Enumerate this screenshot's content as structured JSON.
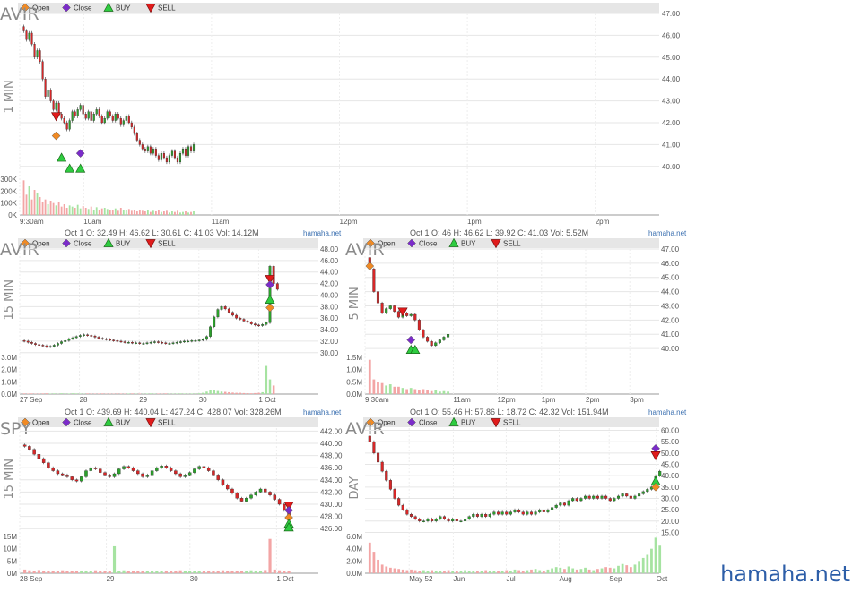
{
  "watermark": "hamaha.net",
  "colors": {
    "up": "#2ca02c",
    "down": "#d62728",
    "open": "#f08a24",
    "close": "#7b2cc9",
    "buy": "#2ecc40",
    "sell": "#e01b1b",
    "vol_up": "#a6e3a1",
    "vol_down": "#f3a5a5",
    "bar": "#e6e6e6",
    "link": "#3a6fb0"
  },
  "legend": [
    "Open",
    "Close",
    "BUY",
    "SELL"
  ],
  "panels": [
    {
      "id": "p1",
      "ticker": "AVIR",
      "timeframe": "1 MIN",
      "info": "Oct 1 O: 46 H: 46.62 L: 39.92 C: 41.03    Vol: 5.52M",
      "site": "hamaha.net",
      "y_ticks": [
        "47.00",
        "46.00",
        "45.00",
        "44.00",
        "43.00",
        "42.00",
        "41.00",
        "40.00"
      ],
      "vol_ticks": [
        "300K",
        "200K",
        "100K",
        "0K"
      ],
      "x_labels": [
        "9:30am",
        "10am",
        "11am",
        "12pm",
        "1pm",
        "2pm"
      ]
    },
    {
      "id": "p2",
      "ticker": "AVIR",
      "timeframe": "15 MIN",
      "info": "Oct 1 O: 32.49 H: 46.62 L: 30.61 C: 41.03    Vol: 14.12M",
      "site": "hamaha.net",
      "y_ticks": [
        "48.00",
        "46.00",
        "44.00",
        "42.00",
        "40.00",
        "38.00",
        "36.00",
        "34.00",
        "32.00",
        "30.00"
      ],
      "vol_ticks": [
        "3.0M",
        "2.0M",
        "1.0M",
        "0.0M"
      ],
      "x_labels": [
        "27 Sep",
        "28",
        "29",
        "30",
        "1 Oct"
      ]
    },
    {
      "id": "p3",
      "ticker": "AVIR",
      "timeframe": "5 MIN",
      "info": "Oct 1 O: 46 H: 46.62 L: 39.92 C: 41.03    Vol: 5.52M",
      "site": "hamaha.net",
      "y_ticks": [
        "47.00",
        "46.00",
        "45.00",
        "44.00",
        "43.00",
        "42.00",
        "41.00",
        "40.00"
      ],
      "vol_ticks": [
        "1.5M",
        "1.0M",
        "0.5M",
        "0.0M"
      ],
      "x_labels": [
        "9:30am",
        "11am",
        "12pm",
        "1pm",
        "2pm",
        "3pm"
      ]
    },
    {
      "id": "p4",
      "ticker": "SPY",
      "timeframe": "15 MIN",
      "info": "Oct 1 O: 439.69 H: 440.04 L: 427.24 C: 428.07    Vol: 328.26M",
      "site": "hamaha.net",
      "y_ticks": [
        "442.00",
        "440.00",
        "438.00",
        "436.00",
        "434.00",
        "432.00",
        "430.00",
        "428.00",
        "426.00"
      ],
      "vol_ticks": [
        "15M",
        "10M",
        "5M",
        "0M"
      ],
      "x_labels": [
        "28 Sep",
        "29",
        "30",
        "1 Oct"
      ]
    },
    {
      "id": "p5",
      "ticker": "AVIR",
      "timeframe": "DAY",
      "info": "Oct 1 O: 55.46 H: 57.86 L: 18.72 C: 42.32    Vol: 151.94M",
      "site": "hamaha.net",
      "y_ticks": [
        "60.00",
        "55.00",
        "50.00",
        "45.00",
        "40.00",
        "35.00",
        "30.00",
        "25.00",
        "20.00",
        "15.00"
      ],
      "vol_ticks": [
        "6.0M",
        "4.0M",
        "2.0M",
        "0.0M"
      ],
      "x_labels": [
        "May 52",
        "Jun",
        "Jul",
        "Aug",
        "Sep",
        "Oct"
      ]
    }
  ],
  "chart_data": [
    {
      "type": "candlestick",
      "ticker": "AVIR",
      "interval": "1 MIN",
      "ylim": [
        39.5,
        47.0
      ],
      "x_labels": [
        "9:30am",
        "10am",
        "11am",
        "12pm",
        "1pm",
        "2pm"
      ],
      "close": [
        46.2,
        45.8,
        46.1,
        45.6,
        45.0,
        45.3,
        44.8,
        44.0,
        43.2,
        43.5,
        43.0,
        42.6,
        42.9,
        42.4,
        42.2,
        42.0,
        41.7,
        42.1,
        42.5,
        42.3,
        42.6,
        42.8,
        42.4,
        42.2,
        42.5,
        42.1,
        42.4,
        42.6,
        42.3,
        42.0,
        42.2,
        42.5,
        42.3,
        42.1,
        42.4,
        42.2,
        41.9,
        42.1,
        42.3,
        42.0,
        41.8,
        41.5,
        41.2,
        41.0,
        40.8,
        40.7,
        40.9,
        40.6,
        40.8,
        40.5,
        40.3,
        40.6,
        40.4,
        40.2,
        40.5,
        40.7,
        40.4,
        40.2,
        40.6,
        40.8,
        40.5,
        40.9,
        40.7,
        41.0
      ],
      "volume_k": [
        290,
        170,
        240,
        130,
        210,
        180,
        150,
        110,
        130,
        90,
        120,
        100,
        80,
        110,
        70,
        90,
        60,
        80,
        70,
        60,
        85,
        55,
        75,
        60,
        50,
        70,
        45,
        65,
        40,
        55,
        60,
        50,
        45,
        40,
        55,
        35,
        60,
        45,
        40,
        50,
        35,
        45,
        30,
        40,
        35,
        30,
        45,
        25,
        35,
        30,
        40,
        25,
        30,
        35,
        20,
        30,
        25,
        35,
        20,
        25,
        30,
        20,
        25,
        30
      ],
      "markers": [
        {
          "type": "open",
          "x": 12,
          "y": 41.4
        },
        {
          "type": "sell",
          "x": 12,
          "y": 42.3
        },
        {
          "type": "buy",
          "x": 14,
          "y": 40.4
        },
        {
          "type": "buy",
          "x": 17,
          "y": 39.9
        },
        {
          "type": "buy",
          "x": 21,
          "y": 39.9
        },
        {
          "type": "close",
          "x": 21,
          "y": 40.6
        }
      ]
    },
    {
      "type": "candlestick",
      "ticker": "AVIR",
      "interval": "15 MIN",
      "ylim": [
        29.5,
        48.0
      ],
      "x_labels": [
        "27 Sep",
        "28",
        "29",
        "30",
        "1 Oct"
      ],
      "close": [
        32.0,
        31.8,
        31.6,
        31.4,
        31.3,
        31.2,
        31.0,
        31.1,
        31.3,
        31.6,
        31.9,
        32.1,
        32.4,
        32.6,
        32.8,
        33.0,
        33.1,
        33.0,
        32.9,
        32.7,
        32.5,
        32.4,
        32.3,
        32.2,
        32.1,
        32.0,
        31.9,
        31.8,
        31.8,
        31.7,
        31.7,
        31.6,
        31.6,
        31.7,
        31.8,
        31.9,
        31.8,
        31.7,
        31.6,
        31.6,
        31.7,
        31.8,
        31.9,
        32.0,
        32.0,
        32.1,
        32.1,
        32.2,
        32.3,
        32.8,
        34.5,
        36.2,
        37.5,
        38.0,
        37.6,
        37.0,
        36.5,
        36.0,
        35.8,
        35.5,
        35.3,
        35.0,
        34.8,
        34.7,
        34.9,
        35.2,
        45.0,
        42.0,
        41.0
      ],
      "volume_m": [
        0.05,
        0.04,
        0.05,
        0.03,
        0.04,
        0.05,
        0.06,
        0.04,
        0.05,
        0.03,
        0.06,
        0.05,
        0.04,
        0.06,
        0.05,
        0.04,
        0.03,
        0.05,
        0.04,
        0.03,
        0.04,
        0.05,
        0.03,
        0.04,
        0.03,
        0.05,
        0.04,
        0.03,
        0.04,
        0.05,
        0.03,
        0.04,
        0.03,
        0.04,
        0.05,
        0.03,
        0.04,
        0.03,
        0.05,
        0.04,
        0.03,
        0.04,
        0.05,
        0.04,
        0.03,
        0.04,
        0.05,
        0.06,
        0.1,
        0.2,
        0.3,
        0.35,
        0.25,
        0.2,
        0.18,
        0.15,
        0.12,
        0.1,
        0.1,
        0.08,
        0.07,
        0.06,
        0.08,
        0.1,
        0.15,
        2.3,
        1.2,
        0.7
      ],
      "markers": [
        {
          "type": "open",
          "x": 66,
          "y": 37.8
        },
        {
          "type": "buy",
          "x": 66,
          "y": 39.2
        },
        {
          "type": "sell",
          "x": 66,
          "y": 42.8
        },
        {
          "type": "close",
          "x": 66,
          "y": 41.8
        }
      ]
    },
    {
      "type": "candlestick",
      "ticker": "AVIR",
      "interval": "5 MIN",
      "ylim": [
        39.5,
        47.0
      ],
      "x_labels": [
        "9:30am",
        "11am",
        "12pm",
        "1pm",
        "2pm",
        "3pm"
      ],
      "close": [
        45.6,
        44.0,
        43.2,
        42.5,
        42.8,
        43.0,
        42.6,
        42.2,
        42.5,
        42.3,
        42.4,
        42.0,
        41.3,
        40.8,
        40.5,
        40.2,
        40.4,
        40.6,
        40.8,
        41.0
      ],
      "volume_m": [
        1.4,
        0.6,
        0.5,
        0.45,
        0.35,
        0.4,
        0.3,
        0.3,
        0.25,
        0.2,
        0.25,
        0.2,
        0.15,
        0.2,
        0.15,
        0.12,
        0.15,
        0.1,
        0.12,
        0.1
      ],
      "markers": [
        {
          "type": "open",
          "x": 0,
          "y": 45.8
        },
        {
          "type": "sell",
          "x": 8,
          "y": 42.6
        },
        {
          "type": "buy",
          "x": 10,
          "y": 39.9
        },
        {
          "type": "buy",
          "x": 11,
          "y": 39.9
        },
        {
          "type": "close",
          "x": 10,
          "y": 40.6
        }
      ]
    },
    {
      "type": "candlestick",
      "ticker": "SPY",
      "interval": "15 MIN",
      "ylim": [
        425.0,
        442.5
      ],
      "x_labels": [
        "28 Sep",
        "29",
        "30",
        "1 Oct"
      ],
      "close": [
        439.5,
        439.0,
        438.2,
        437.5,
        436.8,
        436.0,
        435.5,
        435.0,
        434.8,
        434.5,
        434.0,
        433.8,
        434.5,
        435.5,
        436.0,
        435.8,
        435.2,
        434.8,
        434.5,
        435.0,
        435.8,
        436.2,
        436.0,
        435.5,
        435.0,
        434.5,
        434.8,
        435.5,
        436.0,
        436.3,
        436.0,
        435.5,
        435.0,
        434.5,
        434.8,
        435.2,
        435.8,
        436.2,
        436.0,
        435.5,
        434.8,
        434.0,
        433.2,
        432.5,
        431.8,
        431.0,
        430.5,
        431.0,
        431.5,
        432.0,
        432.5,
        432.0,
        431.5,
        430.8,
        430.0,
        429.0,
        428.0
      ],
      "volume_m": [
        1.5,
        1.2,
        1.0,
        1.3,
        0.9,
        1.1,
        0.8,
        1.0,
        1.2,
        0.9,
        1.0,
        0.8,
        1.1,
        0.9,
        1.0,
        1.2,
        0.8,
        1.0,
        0.9,
        11.0,
        1.0,
        1.2,
        0.9,
        1.0,
        0.8,
        1.1,
        0.9,
        1.0,
        0.8,
        0.9,
        1.1,
        0.9,
        1.0,
        1.2,
        0.9,
        1.0,
        0.8,
        1.0,
        0.9,
        1.1,
        0.9,
        1.0,
        1.2,
        1.0,
        0.9,
        1.1,
        1.0,
        0.9,
        1.2,
        1.1,
        1.0,
        1.3,
        14.0,
        1.5,
        1.2,
        1.0,
        1.1
      ],
      "markers": [
        {
          "type": "sell",
          "x": 56,
          "y": 429.8
        },
        {
          "type": "close",
          "x": 56,
          "y": 429.0
        },
        {
          "type": "open",
          "x": 56,
          "y": 427.8
        },
        {
          "type": "buy",
          "x": 56,
          "y": 426.8
        },
        {
          "type": "buy",
          "x": 56,
          "y": 426.2
        }
      ]
    },
    {
      "type": "candlestick",
      "ticker": "AVIR",
      "interval": "DAY",
      "ylim": [
        14.0,
        61.0
      ],
      "x_labels": [
        "May 52",
        "Jun",
        "Jul",
        "Aug",
        "Sep",
        "Oct"
      ],
      "close": [
        55,
        50,
        46,
        42,
        38,
        34,
        30,
        27,
        25,
        23,
        22,
        21,
        20,
        20,
        21,
        20,
        21,
        22,
        21,
        20,
        21,
        20,
        20,
        21,
        22,
        23,
        22,
        23,
        22,
        23,
        24,
        23,
        24,
        23,
        24,
        25,
        24,
        23,
        24,
        23,
        24,
        25,
        24,
        25,
        26,
        27,
        28,
        27,
        29,
        30,
        29,
        30,
        31,
        30,
        31,
        30,
        31,
        30,
        29,
        30,
        31,
        32,
        31,
        30,
        31,
        32,
        33,
        34,
        35,
        40,
        42
      ],
      "volume_m": [
        5.0,
        3.5,
        2.2,
        1.4,
        1.1,
        0.9,
        0.8,
        0.7,
        0.6,
        0.5,
        0.6,
        0.5,
        0.4,
        0.5,
        0.4,
        0.5,
        0.4,
        0.3,
        0.4,
        0.5,
        0.4,
        0.3,
        0.4,
        0.5,
        0.4,
        0.3,
        0.4,
        0.3,
        0.5,
        0.4,
        0.3,
        0.4,
        0.3,
        0.5,
        0.4,
        0.6,
        0.5,
        0.4,
        0.5,
        0.6,
        0.7,
        0.5,
        0.4,
        0.6,
        0.8,
        1.0,
        0.9,
        0.7,
        1.1,
        0.8,
        0.6,
        0.7,
        0.9,
        0.6,
        0.5,
        0.7,
        0.8,
        1.0,
        0.9,
        0.8,
        1.2,
        1.5,
        1.3,
        1.0,
        1.4,
        2.0,
        2.5,
        3.0,
        4.0,
        5.8,
        4.5
      ],
      "markers": [
        {
          "type": "close",
          "x": 69,
          "y": 52.0
        },
        {
          "type": "sell",
          "x": 69,
          "y": 49.0
        },
        {
          "type": "buy",
          "x": 69,
          "y": 37.5
        },
        {
          "type": "open",
          "x": 69,
          "y": 35.0
        }
      ]
    }
  ]
}
